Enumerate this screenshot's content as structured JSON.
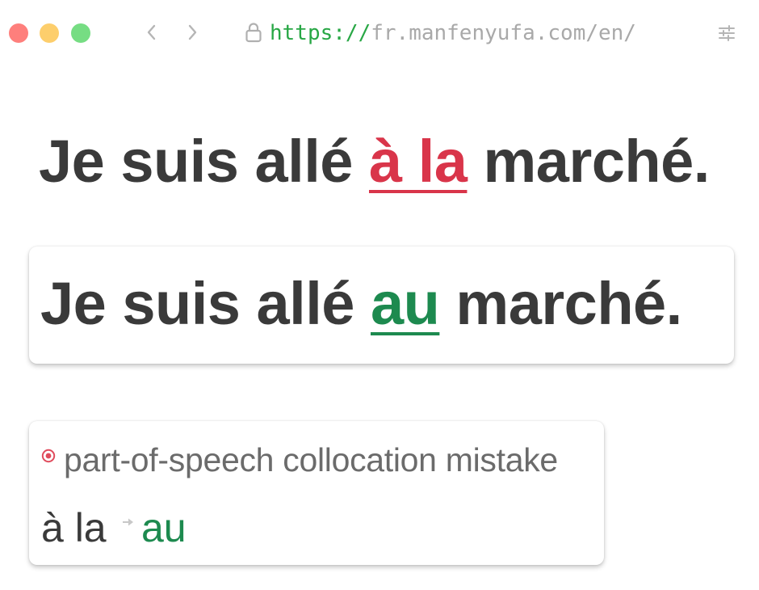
{
  "browser": {
    "url_scheme": "https://",
    "url_host": "fr.manfenyufa.com/en/",
    "icons": [
      "close-dot",
      "minimize-dot",
      "maximize-dot",
      "back-chevron-icon",
      "forward-chevron-icon",
      "lock-icon",
      "settings-sliders-icon"
    ]
  },
  "original": {
    "before": "Je suis allé ",
    "error": "à la",
    "after": " marché."
  },
  "corrected": {
    "before": "Je suis allé ",
    "fix": "au",
    "after": " marché."
  },
  "suggestion": {
    "category": "part-of-speech collocation mistake",
    "from": "à la",
    "to": "au"
  },
  "colors": {
    "error": "#d9354a",
    "correct": "#1d8a4f",
    "url_scheme": "#28a745",
    "text": "#3a3a3a"
  }
}
